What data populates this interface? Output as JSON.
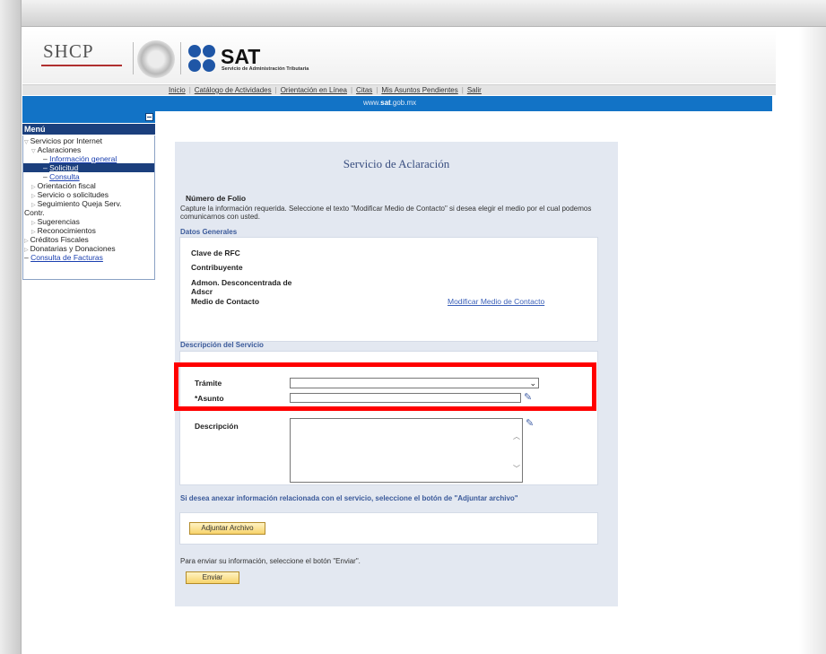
{
  "header": {
    "shcp_logo": "SHCP",
    "sat_logo": "SAT",
    "sat_subtitle": "Servicio de Administración Tributaria"
  },
  "topnav": {
    "items": [
      "Inicio",
      "Catálogo de Actividades",
      "Orientación en Línea",
      "Citas",
      "Mis Asuntos Pendientes",
      "Salir"
    ]
  },
  "bluebar": {
    "prefix": "www.",
    "bold": "sat",
    "suffix": ".gob.mx"
  },
  "sidebar": {
    "title": "Menú",
    "items": {
      "servicios": "Servicios por Internet",
      "aclaraciones": "Aclaraciones",
      "info_general": "Información general",
      "solicitud": "Solicitud",
      "consulta": "Consulta",
      "orientacion": "Orientación fiscal",
      "servicio_solicitudes": "Servicio o solicitudes",
      "seguimiento": "Seguimiento Queja Serv.",
      "seguimiento2": "Contr.",
      "sugerencias": "Sugerencias",
      "reconocimientos": "Reconocimientos",
      "creditos": "Créditos Fiscales",
      "donatarias": "Donatarias y Donaciones",
      "facturas": "Consulta de Facturas"
    }
  },
  "form": {
    "title": "Servicio de Aclaración",
    "folio_label": "Número de Folio",
    "instructions": "Capture la información requerida. Seleccione el texto \"Modificar Medio de Contacto\" si desea elegir el medio por el cual podemos comunicarnos con usted.",
    "datos_generales": {
      "heading": "Datos Generales",
      "rfc_label": "Clave de RFC",
      "contribuyente_label": "Contribuyente",
      "admon_label": "Admon. Desconcentrada de",
      "admon_label2": "Adscr",
      "medio_label": "Medio de Contacto",
      "modificar_link": "Modificar Medio de Contacto"
    },
    "descripcion_servicio": {
      "heading": "Descripción del Servicio",
      "tramite_label": "Trámite",
      "tramite_value": "",
      "asunto_label": "*Asunto",
      "asunto_value": "",
      "descripcion_label": "Descripción",
      "descripcion_value": ""
    },
    "adjuntar": {
      "text": "Si desea anexar información relacionada con el servicio, seleccione el botón de \"Adjuntar archivo\"",
      "button": "Adjuntar Archivo"
    },
    "enviar": {
      "text": "Para enviar su información, seleccione el botón \"Enviar\".",
      "button": "Enviar"
    }
  },
  "colors": {
    "blue_bar": "#1273c6",
    "menu_dark": "#1b3f7d",
    "panel_bg": "#e3e8f1",
    "highlight": "#ff0000",
    "button": "#f7d36b"
  }
}
